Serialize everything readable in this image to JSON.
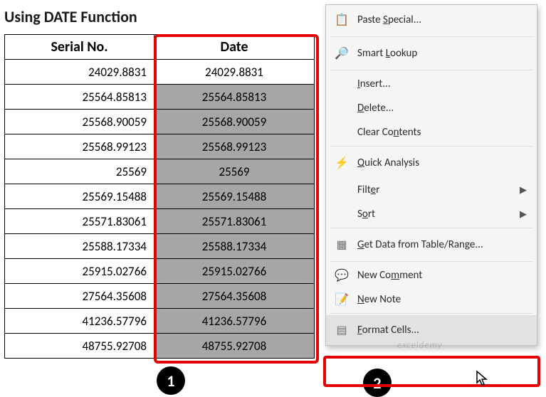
{
  "title": "Using DATE Function",
  "headers": {
    "serial": "Serial No.",
    "date": "Date"
  },
  "rows": [
    {
      "serial": "24029.8831",
      "date": "24029.8831"
    },
    {
      "serial": "25564.85813",
      "date": "25564.85813"
    },
    {
      "serial": "25568.90059",
      "date": "25568.90059"
    },
    {
      "serial": "25568.99123",
      "date": "25568.99123"
    },
    {
      "serial": "25569",
      "date": "25569"
    },
    {
      "serial": "25569.15488",
      "date": "25569.15488"
    },
    {
      "serial": "25571.83061",
      "date": "25571.83061"
    },
    {
      "serial": "25588.17334",
      "date": "25588.17334"
    },
    {
      "serial": "25915.02766",
      "date": "25915.02766"
    },
    {
      "serial": "27564.35608",
      "date": "27564.35608"
    },
    {
      "serial": "41236.57796",
      "date": "41236.57796"
    },
    {
      "serial": "48755.92708",
      "date": "48755.92708"
    }
  ],
  "steps": {
    "badge1": "1",
    "badge2": "2"
  },
  "menu": {
    "paste_special": "Paste Special...",
    "smart_lookup": "Smart Lookup",
    "insert": "Insert...",
    "delete": "Delete...",
    "clear_contents": "Clear Contents",
    "quick_analysis": "Quick Analysis",
    "filter": "Filter",
    "sort": "Sort",
    "get_data": "Get Data from Table/Range...",
    "new_comment": "New Comment",
    "new_note": "New Note",
    "format_cells": "Format Cells..."
  },
  "watermark": "exceldemy"
}
